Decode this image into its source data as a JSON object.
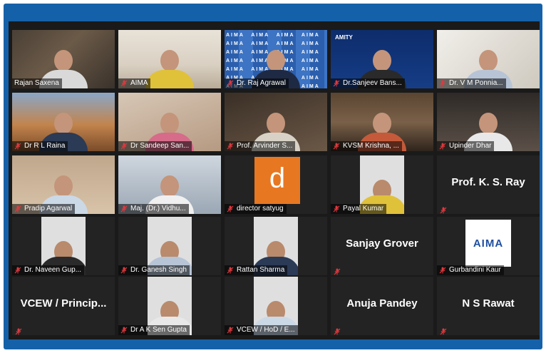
{
  "meeting": {
    "rows": [
      [
        {
          "name": "Rajan Saxena",
          "type": "video",
          "bg": "bg1",
          "active": true,
          "muted": false
        },
        {
          "name": "AIMA",
          "type": "video",
          "bg": "bg2",
          "muted": true
        },
        {
          "name": "Dr. Raj Agrawal",
          "type": "video",
          "bg": "bg3",
          "muted": true
        },
        {
          "name": "Dr.Sanjeev Bans...",
          "type": "video",
          "bg": "bg4",
          "muted": true
        },
        {
          "name": "Dr. V M Ponnia...",
          "type": "video",
          "bg": "bg5",
          "muted": true
        }
      ],
      [
        {
          "name": "Dr R L Raina",
          "type": "video",
          "bg": "bg6",
          "muted": true
        },
        {
          "name": "Dr Sandeep San...",
          "type": "video",
          "bg": "bg7",
          "muted": true
        },
        {
          "name": "Prof. Arvinder S...",
          "type": "video",
          "bg": "bg8",
          "muted": true
        },
        {
          "name": "KVSM Krishna, ...",
          "type": "video",
          "bg": "bg9",
          "muted": true
        },
        {
          "name": "Upinder Dhar",
          "type": "video",
          "bg": "bg10",
          "muted": true
        }
      ],
      [
        {
          "name": "Pradip Agarwal",
          "type": "video",
          "bg": "bg11",
          "muted": true
        },
        {
          "name": "Maj. (Dr.) Vidhu...",
          "type": "video",
          "bg": "bg12",
          "muted": true
        },
        {
          "name": "director satyug",
          "type": "logo-d",
          "logo_text": "d",
          "muted": true
        },
        {
          "name": "Payal Kumar",
          "type": "photo",
          "muted": true
        },
        {
          "name": "",
          "display": "Prof. K. S. Ray",
          "type": "text",
          "muted": true
        }
      ],
      [
        {
          "name": "Dr. Naveen Gup...",
          "type": "photo",
          "muted": true
        },
        {
          "name": "Dr. Ganesh Singh",
          "type": "photo",
          "muted": true
        },
        {
          "name": "Rattan Sharma",
          "type": "photo",
          "muted": true
        },
        {
          "name": "",
          "display": "Sanjay Grover",
          "type": "text",
          "muted": true
        },
        {
          "name": "Gurbandini Kaur",
          "type": "logo-aima",
          "logo_text": "AIMA",
          "muted": true
        }
      ],
      [
        {
          "name": "",
          "display": "VCEW / Princip...",
          "type": "text",
          "muted": true
        },
        {
          "name": "Dr A K Sen Gupta",
          "type": "photo",
          "muted": true
        },
        {
          "name": "VCEW / HoD / E...",
          "type": "photo",
          "muted": true
        },
        {
          "name": "",
          "display": "Anuja Pandey",
          "type": "text",
          "muted": true
        },
        {
          "name": "",
          "display": "N S Rawat",
          "type": "text",
          "muted": true
        }
      ]
    ],
    "overlay_text": {
      "amity": "AMITY",
      "aima_wall": "AIMA AIMA AIMA AIMA AIMA AIMA AIMA AIMA AIMA AIMA AIMA AIMA AIMA AIMA AIMA AIMA AIMA AIMA AIMA AIMA AIMA AIMA AIMA AIMA AIMA AIMA AIMA AIMA AIMA AIMA"
    },
    "colors": {
      "frame": "#1561a9",
      "active_border": "#c9e03a",
      "muted_icon": "#e0393e"
    }
  }
}
